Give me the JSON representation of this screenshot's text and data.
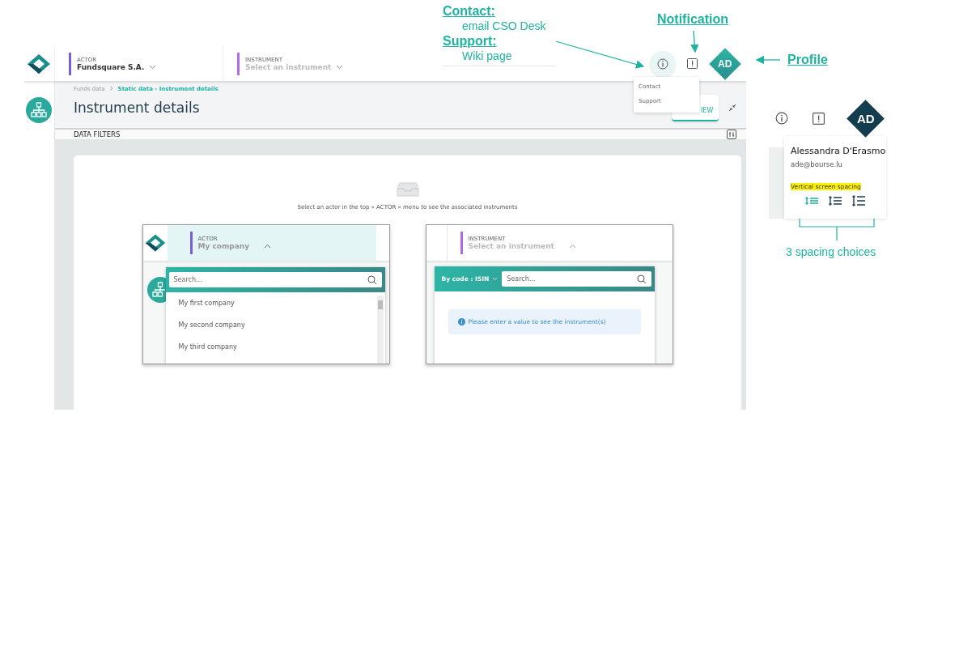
{
  "annotations": {
    "contact": {
      "title": "Contact:",
      "detail": "email CSO Desk"
    },
    "support": {
      "title": "Support:",
      "detail": "Wiki page"
    },
    "notification": "Notification",
    "profile": "Profile",
    "spacing_note": "3 spacing choices"
  },
  "header": {
    "selectors": [
      {
        "label": "ACTOR",
        "value": "Fundsquare S.A.",
        "empty": false
      },
      {
        "label": "INSTRUMENT",
        "value": "Select an instrument",
        "empty": true
      }
    ],
    "avatar": "AD",
    "info_menu": [
      "Contact",
      "Support"
    ]
  },
  "breadcrumb": [
    "Funds data",
    "Static data - Instrument details"
  ],
  "page_title": "Instrument details",
  "view_tab": "IEW",
  "filters": {
    "title": "DATA FILTERS"
  },
  "empty_message": "Select an actor in the top « ACTOR » menu to see the associated instruments",
  "actor_example": {
    "label": "ACTOR",
    "value": "My company",
    "search_placeholder": "Search...",
    "items": [
      "My first company",
      "My second company",
      "My third company"
    ]
  },
  "instrument_example": {
    "label": "INSTRUMENT",
    "value": "Select an instrument",
    "code_filter": "By code : ISIN",
    "search_placeholder": "Search...",
    "message": "Please enter a value to see the instrument(s)"
  },
  "profile_panel": {
    "avatar": "AD",
    "name": "Alessandra D'Erasmo",
    "email": "ade@bourse.lu",
    "spacing_label": "Vertical screen spacing",
    "spacing_options": [
      {
        "kind": "compact",
        "selected": true
      },
      {
        "kind": "normal",
        "selected": false
      },
      {
        "kind": "wide",
        "selected": false
      }
    ]
  }
}
